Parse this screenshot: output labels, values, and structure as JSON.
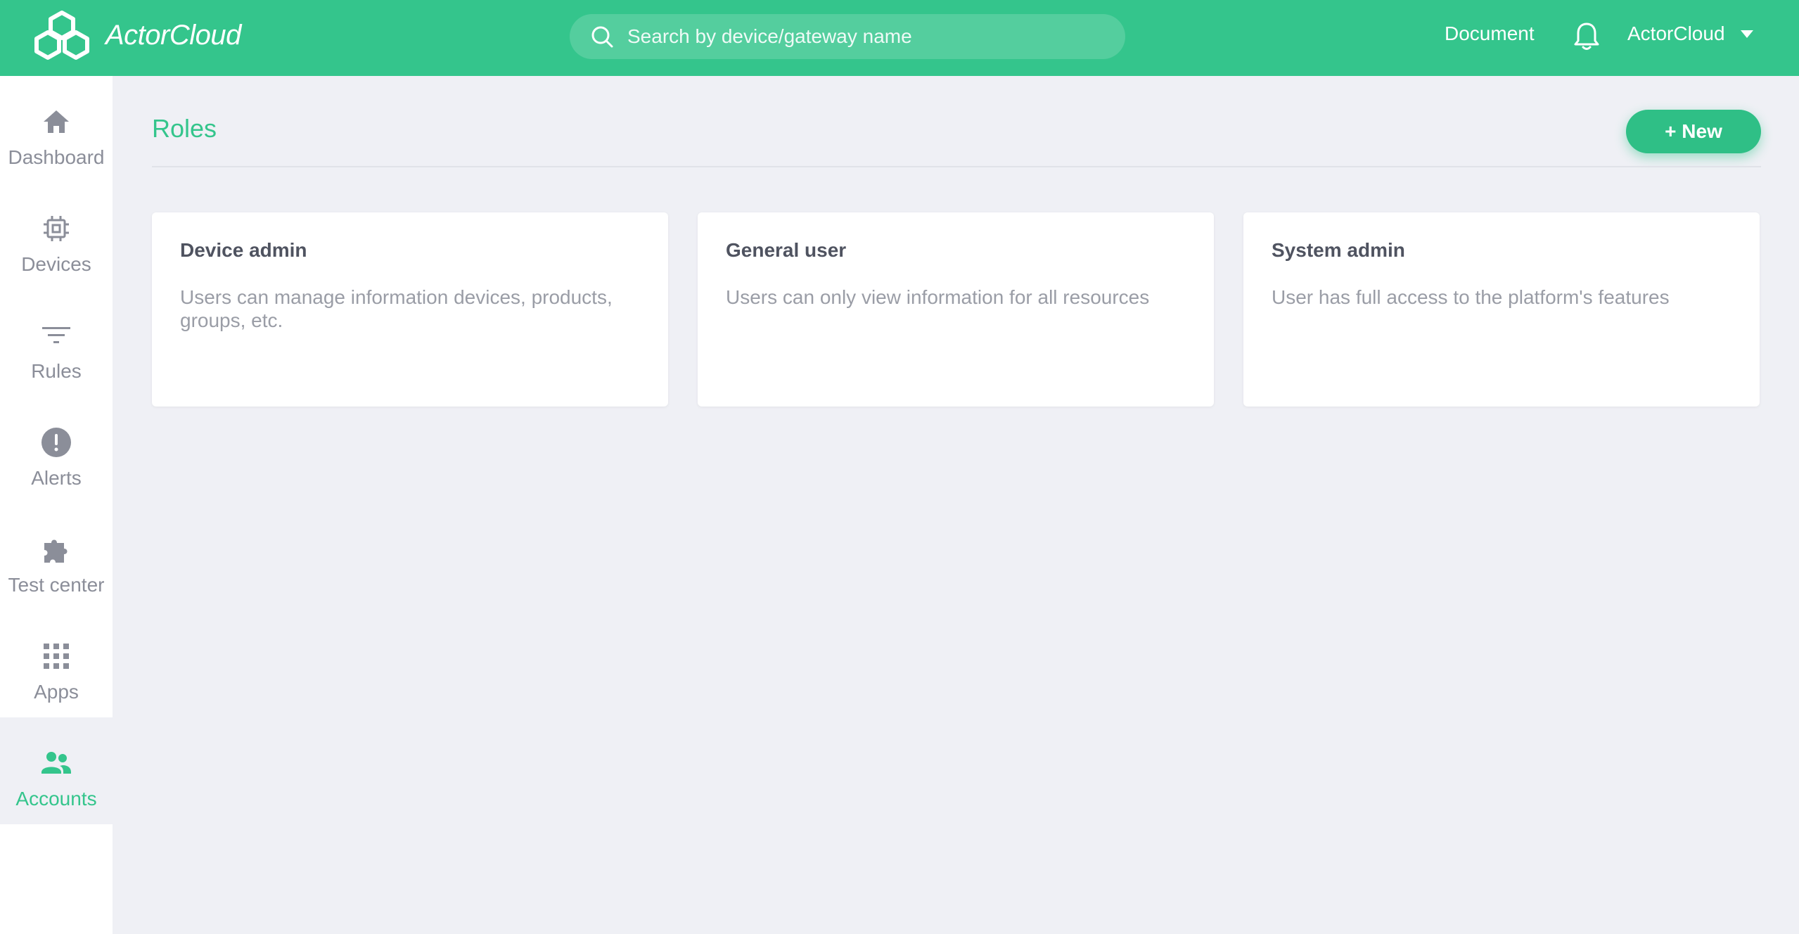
{
  "header": {
    "logo_text": "ActorCloud",
    "search_placeholder": "Search by device/gateway name",
    "document_link": "Document",
    "user_name": "ActorCloud",
    "brand_color": "#34c58c"
  },
  "sidebar": {
    "items": [
      {
        "label": "Dashboard",
        "icon": "home-icon",
        "active": false
      },
      {
        "label": "Devices",
        "icon": "chip-icon",
        "active": false
      },
      {
        "label": "Rules",
        "icon": "filter-icon",
        "active": false
      },
      {
        "label": "Alerts",
        "icon": "alert-icon",
        "active": false
      },
      {
        "label": "Test center",
        "icon": "puzzle-icon",
        "active": false
      },
      {
        "label": "Apps",
        "icon": "grid-icon",
        "active": false
      },
      {
        "label": "Accounts",
        "icon": "people-icon",
        "active": true
      }
    ]
  },
  "main": {
    "title": "Roles",
    "new_button": "+ New",
    "cards": [
      {
        "title": "Device admin",
        "description": "Users can manage information devices, products, groups, etc."
      },
      {
        "title": "General user",
        "description": "Users can only view information for all resources"
      },
      {
        "title": "System admin",
        "description": "User has full access to the platform's features"
      }
    ]
  }
}
